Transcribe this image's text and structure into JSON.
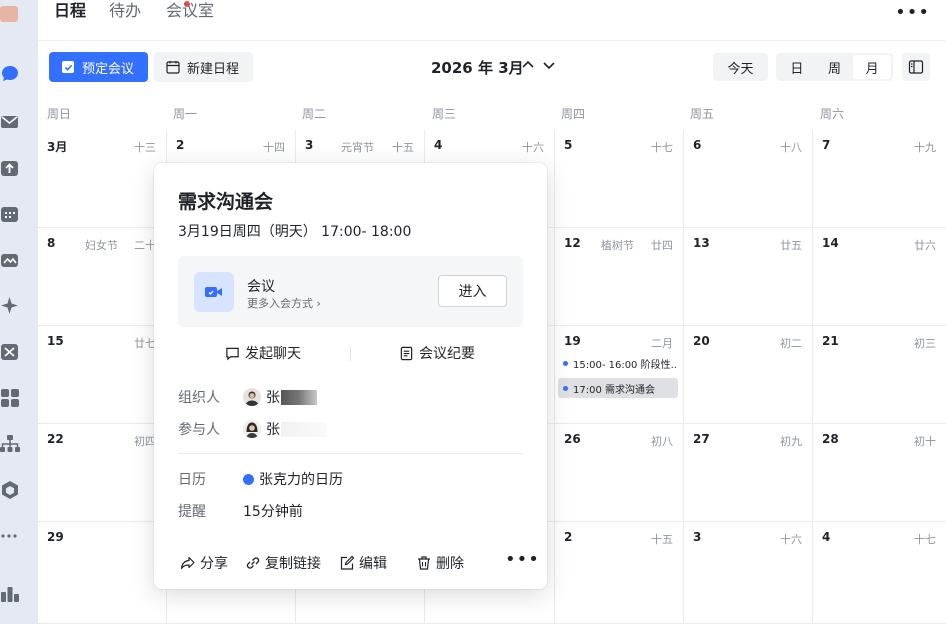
{
  "header": {
    "tabs": [
      {
        "label": "日程",
        "active": true
      },
      {
        "label": "待办",
        "badge": true
      },
      {
        "label": "会议室"
      }
    ],
    "more": "•••"
  },
  "toolbar": {
    "book_meeting": "预定会议",
    "new_event": "新建日程",
    "month_title": "2026 年 3月",
    "today": "今天",
    "views": [
      "日",
      "周",
      "月"
    ],
    "active_view": "月"
  },
  "weekdays": [
    "周日",
    "周一",
    "周二",
    "周三",
    "周四",
    "周五",
    "周六"
  ],
  "weeks": [
    [
      {
        "day": "3月",
        "lunar": "十三"
      },
      {
        "day": "2",
        "lunar": "十四"
      },
      {
        "day": "3",
        "lunar": "十五",
        "festival": "元宵节"
      },
      {
        "day": "4",
        "lunar": "十六"
      },
      {
        "day": "5",
        "lunar": "十七"
      },
      {
        "day": "6",
        "lunar": "十八"
      },
      {
        "day": "7",
        "lunar": "十九"
      }
    ],
    [
      {
        "day": "8",
        "lunar": "二十",
        "festival": "妇女节"
      },
      {
        "day": "",
        "lunar": ""
      },
      {
        "day": "",
        "lunar": ""
      },
      {
        "day": "",
        "lunar": ""
      },
      {
        "day": "12",
        "lunar": "廿四",
        "festival": "植树节"
      },
      {
        "day": "13",
        "lunar": "廿五"
      },
      {
        "day": "14",
        "lunar": "廿六"
      }
    ],
    [
      {
        "day": "15",
        "lunar": "廿七"
      },
      {
        "day": "",
        "lunar": ""
      },
      {
        "day": "",
        "lunar": ""
      },
      {
        "day": "",
        "lunar": ""
      },
      {
        "day": "19",
        "lunar": "二月"
      },
      {
        "day": "20",
        "lunar": "初二"
      },
      {
        "day": "21",
        "lunar": "初三"
      }
    ],
    [
      {
        "day": "22",
        "lunar": "初四"
      },
      {
        "day": "",
        "lunar": ""
      },
      {
        "day": "",
        "lunar": ""
      },
      {
        "day": "",
        "lunar": ""
      },
      {
        "day": "26",
        "lunar": "初八"
      },
      {
        "day": "27",
        "lunar": "初九"
      },
      {
        "day": "28",
        "lunar": "初十"
      }
    ],
    [
      {
        "day": "29",
        "lunar": ""
      },
      {
        "day": "",
        "lunar": ""
      },
      {
        "day": "",
        "lunar": ""
      },
      {
        "day": "",
        "lunar": ""
      },
      {
        "day": "2",
        "lunar": "十五"
      },
      {
        "day": "3",
        "lunar": "十六"
      },
      {
        "day": "4",
        "lunar": "十七"
      }
    ]
  ],
  "events": [
    {
      "label": "15:00- 16:00 阶段性...",
      "selected": false
    },
    {
      "label": "17:00 需求沟通会",
      "selected": true
    }
  ],
  "popover": {
    "title": "需求沟通会",
    "time": "3月19日周四（明天） 17:00- 18:00",
    "meeting_label": "会议",
    "meeting_more": "更多入会方式 ›",
    "enter": "进入",
    "start_chat": "发起聊天",
    "minutes": "会议纪要",
    "organizer_label": "组织人",
    "organizer_name": "张",
    "attendees_label": "参与人",
    "attendee_name": "张",
    "calendar_label": "日历",
    "calendar_name": "张克力的日历",
    "reminder_label": "提醒",
    "reminder_value": "15分钟前",
    "share": "分享",
    "copy_link": "复制链接",
    "edit": "编辑",
    "delete": "删除",
    "more": "•••"
  },
  "colors": {
    "accent": "#3370ff",
    "rail": "#e4e9f3"
  }
}
